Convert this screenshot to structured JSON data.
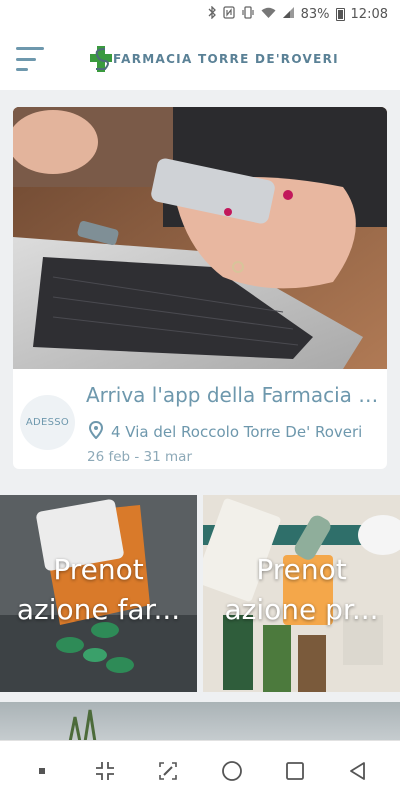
{
  "status_bar": {
    "battery": "83%",
    "time": "12:08",
    "icons": [
      "bluetooth-icon",
      "nfc-icon",
      "vibrate-icon",
      "wifi-icon",
      "signal-icon",
      "battery-icon"
    ]
  },
  "header": {
    "app_name": "FARMACIA TORRE DE'ROVERI",
    "menu_icon": "hamburger-menu-icon",
    "logo_icon": "pharmacy-cross-logo"
  },
  "event": {
    "badge": "ADESSO",
    "title": "Arriva l'app della Farmacia Torre De' Roveri",
    "address_icon": "location-pin-icon",
    "address": "4 Via del Roccolo Torre De' Roveri",
    "dates": "26 feb - 31 mar"
  },
  "tiles": [
    {
      "line1": "Prenot",
      "line2": "azione far..."
    },
    {
      "line1": "Prenot",
      "line2": "azione pr..."
    }
  ],
  "nav_bar": {
    "icons": [
      "dot-icon",
      "collapse-icon",
      "screenshot-edit-icon",
      "home-circle-icon",
      "recent-apps-square-icon",
      "back-triangle-icon"
    ]
  },
  "colors": {
    "accent": "#6e98ad",
    "background": "#eef0f2",
    "logo_green": "#3a9a3e"
  }
}
